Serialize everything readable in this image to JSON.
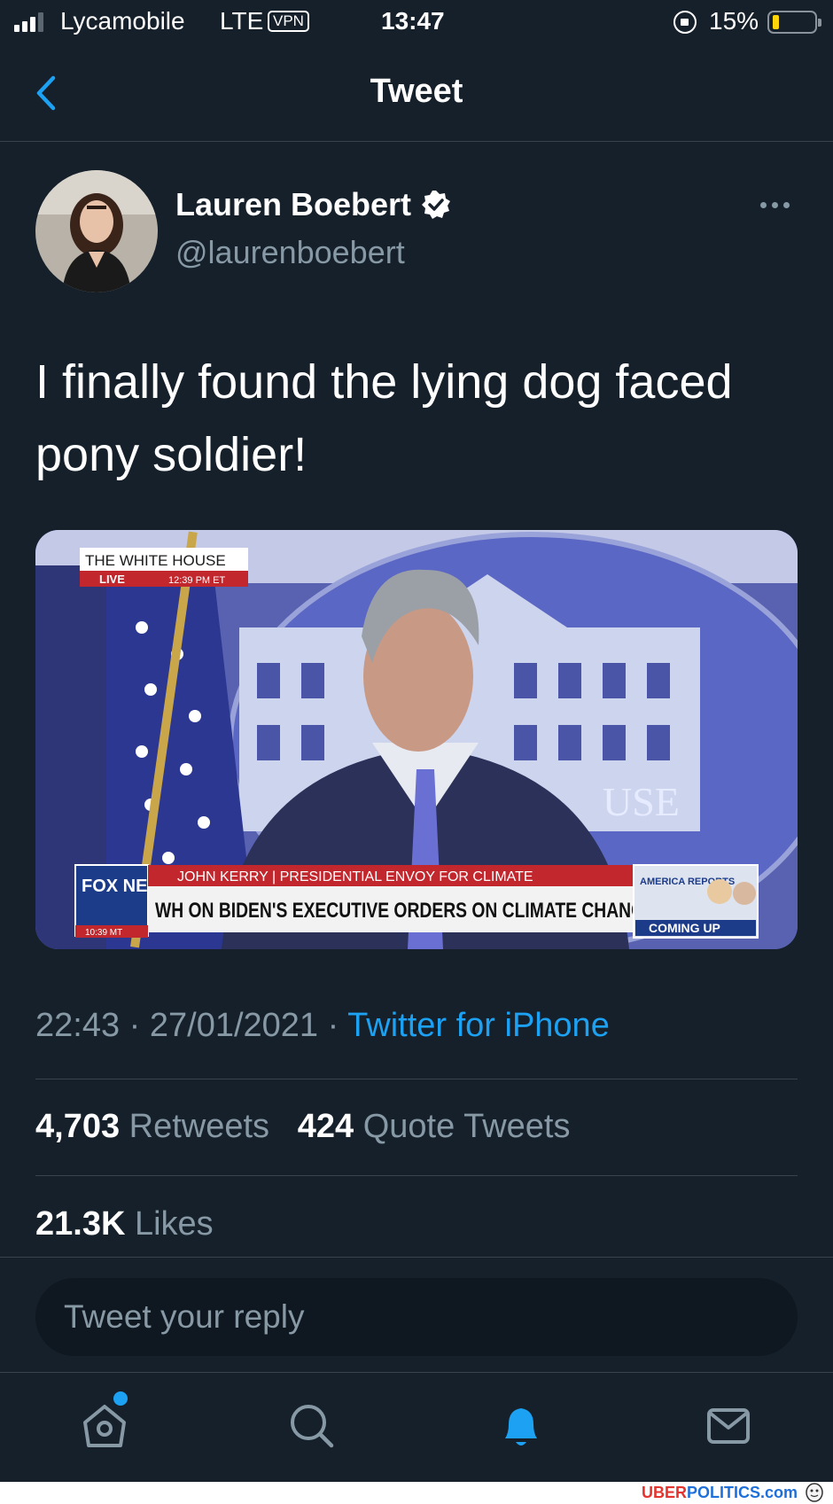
{
  "status_bar": {
    "carrier": "Lycamobile",
    "network": "LTE",
    "vpn": "VPN",
    "time": "13:47",
    "battery": "15%"
  },
  "header": {
    "title": "Tweet"
  },
  "tweet": {
    "author_name": "Lauren Boebert",
    "author_handle": "@laurenboebert",
    "text": "I finally found the lying dog faced pony soldier!",
    "media": {
      "tv_banner_top": "THE WHITE HOUSE",
      "tv_live": "LIVE",
      "tv_time": "12:39 PM ET",
      "lower_third_name": "JOHN KERRY | PRESIDENTIAL ENVOY FOR CLIMATE",
      "lower_third_headline": "WH ON BIDEN'S EXECUTIVE ORDERS ON CLIMATE CHANGE",
      "network_logo": "FOX NEWS",
      "network_clock": "10:39 MT",
      "promo_show": "AMERICA REPORTS",
      "promo_label": "COMING UP",
      "podium_text": "USE"
    },
    "timestamp": "22:43 · 27/01/2021 · ",
    "source": "Twitter for iPhone",
    "retweets_count": "4,703",
    "retweets_label": "Retweets",
    "quote_count": "424",
    "quote_label": "Quote Tweets",
    "likes_count": "21.3K",
    "likes_label": "Likes"
  },
  "reply": {
    "placeholder": "Tweet your reply"
  },
  "tabbar": {
    "icons": [
      "home-icon",
      "search-icon",
      "notifications-icon",
      "messages-icon"
    ]
  },
  "watermark": {
    "part1": "UBER",
    "part2": "POLITICS",
    "part3": ".com"
  },
  "colors": {
    "background": "#15202b",
    "accent": "#1da1f2",
    "secondary_text": "#8899a6",
    "divider": "#38444d"
  }
}
